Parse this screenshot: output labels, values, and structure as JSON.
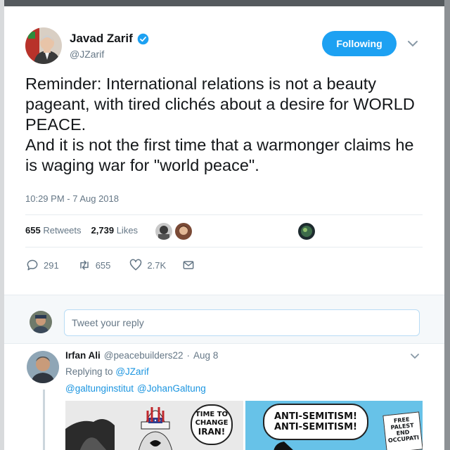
{
  "tweet": {
    "author_name": "Javad Zarif",
    "author_handle": "@JZarif",
    "follow_label": "Following",
    "text_para_1": "Reminder: International relations is not a beauty pageant, with tired clichés about a desire for WORLD PEACE.",
    "text_para_2": "And it is not the first time that a warmonger claims he is waging war for \"world peace\".",
    "timestamp": "10:29 PM - 7 Aug 2018",
    "retweets_count": "655",
    "retweets_label": "Retweets",
    "likes_count": "2,739",
    "likes_label": "Likes"
  },
  "actions": {
    "reply_count": "291",
    "retweet_count": "655",
    "like_count": "2.7K"
  },
  "reply_box": {
    "placeholder": "Tweet your reply"
  },
  "reply": {
    "author_name": "Irfan Ali",
    "author_handle": "@peacebuilders22",
    "separator": "·",
    "date": "Aug 8",
    "replying_prefix": "Replying to",
    "replying_to": "@JZarif",
    "mention_1": "@galtunginstitut",
    "mention_2": "@JohanGaltung",
    "cartoon_left_bubble_line_1": "TIME TO",
    "cartoon_left_bubble_line_2": "CHANGE",
    "cartoon_left_bubble_line_3": "IRAN!",
    "cartoon_right_bubble_line_1": "ANTI-SEMITISM!",
    "cartoon_right_bubble_line_2": "ANTI-SEMITISM!",
    "cartoon_right_sign_line_1": "FREE",
    "cartoon_right_sign_line_2": "PALEST",
    "cartoon_right_sign_line_3": "END",
    "cartoon_right_sign_line_4": "OCCUPATI"
  },
  "colors": {
    "accent": "#1da1f2",
    "link": "#1b95e0",
    "muted": "#657786"
  }
}
